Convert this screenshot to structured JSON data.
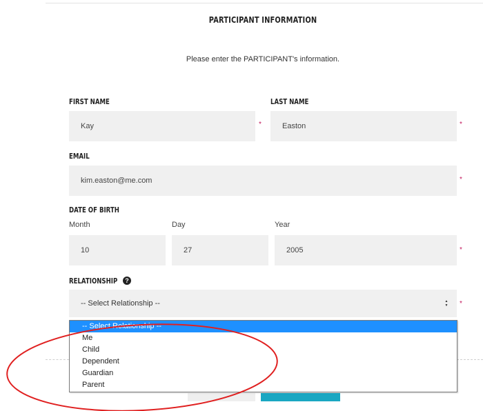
{
  "form": {
    "title": "PARTICIPANT INFORMATION",
    "subtitle": "Please enter the PARTICIPANT's information.",
    "first_name": {
      "label": "FIRST NAME",
      "value": "Kay"
    },
    "last_name": {
      "label": "LAST NAME",
      "value": "Easton"
    },
    "email": {
      "label": "EMAIL",
      "value": "kim.easton@me.com"
    },
    "dob": {
      "label": "DATE OF BIRTH",
      "month_label": "Month",
      "month_value": "10",
      "day_label": "Day",
      "day_value": "27",
      "year_label": "Year",
      "year_value": "2005"
    },
    "relationship": {
      "label": "RELATIONSHIP",
      "help_icon": "?",
      "selected": "-- Select Relationship --",
      "arrow": "▲▼",
      "options": [
        "-- Select Relationship --",
        "Me",
        "Child",
        "Dependent",
        "Guardian",
        "Parent"
      ]
    },
    "required_marker": "*"
  },
  "colors": {
    "field_bg": "#f0f0f0",
    "required": "#c2185b",
    "option_highlight": "#1e90ff",
    "annotation": "#e02020",
    "button_primary": "#1aa7c2"
  },
  "icons": {
    "help": "question-circle-icon",
    "dropdown": "chevron-updown-icon"
  }
}
